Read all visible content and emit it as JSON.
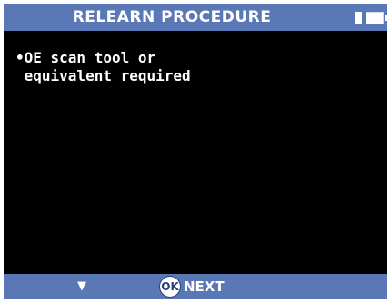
{
  "header": {
    "title": "RELEARN PROCEDURE",
    "battery_icon": "battery-icon"
  },
  "content": {
    "lines": [
      "•OE scan tool or",
      " equivalent required"
    ]
  },
  "footer": {
    "down_arrow": "▼",
    "ok_badge": "OK",
    "next_label": "NEXT"
  },
  "colors": {
    "header_bg": "#5b78b6",
    "screen_bg": "#000000",
    "text": "#ffffff"
  }
}
